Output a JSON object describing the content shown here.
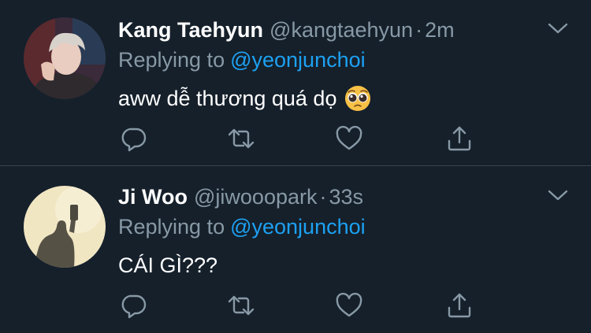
{
  "tweets": [
    {
      "name": "Kang Taehyun",
      "handle": "@kangtaehyun",
      "separator": "·",
      "time": "2m",
      "replying_label": "Replying to",
      "replying_to": "@yeonjunchoi",
      "text": "aww dễ thương quá dọ",
      "emoji": "pleading-face",
      "avatar": "photo-man-dark-hair",
      "actions": [
        "reply-icon",
        "retweet-icon",
        "like-icon",
        "share-icon"
      ]
    },
    {
      "name": "Ji Woo",
      "handle": "@jiwooopark",
      "separator": "·",
      "time": "33s",
      "replying_label": "Replying to",
      "replying_to": "@yeonjunchoi",
      "text": "CÁI GÌ???",
      "avatar": "photo-silhouette-cream",
      "actions": [
        "reply-icon",
        "retweet-icon",
        "like-icon",
        "share-icon"
      ]
    }
  ],
  "colors": {
    "background": "#15202b",
    "primary_text": "#ffffff",
    "secondary_text": "#8899a6",
    "link": "#1da1f2",
    "divider": "#38444d"
  }
}
